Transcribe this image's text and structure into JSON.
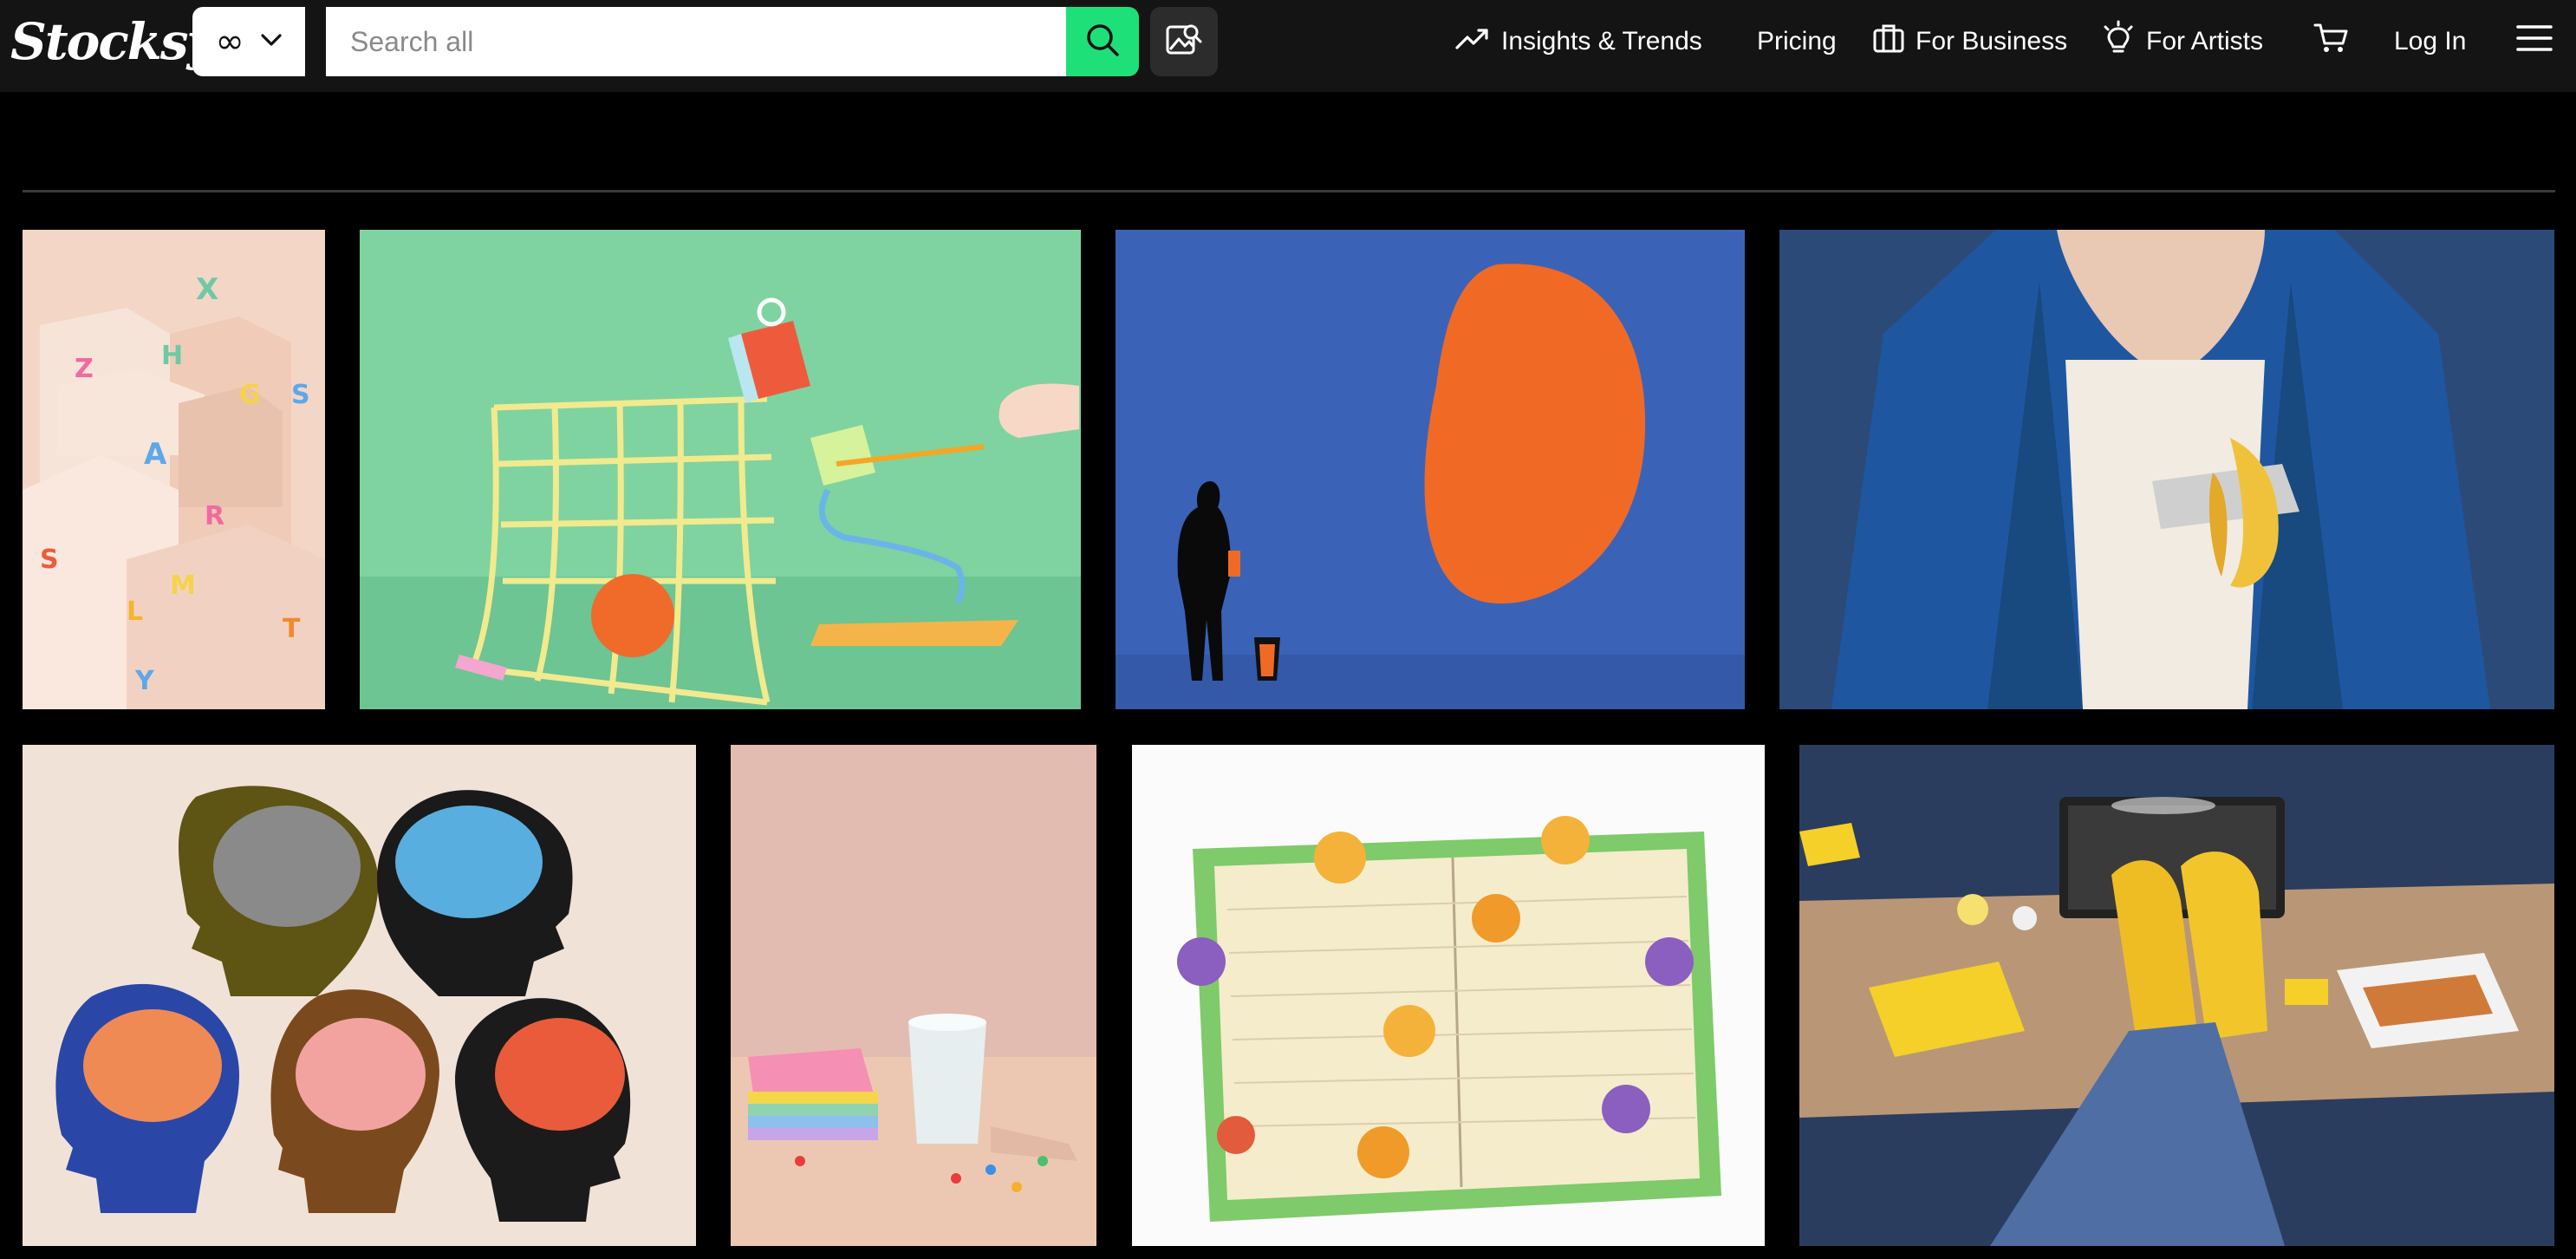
{
  "brand": {
    "logo_text": "Stocksy"
  },
  "search": {
    "scope": "∞",
    "placeholder": "Search all"
  },
  "nav": {
    "insights": "Insights & Trends",
    "pricing": "Pricing",
    "business": "For Business",
    "artists": "For Artists",
    "login": "Log In"
  },
  "colors": {
    "accent": "#1ee079",
    "header_bg": "#141414",
    "page_bg": "#000000"
  },
  "gallery": [
    {
      "name": "photo-alphabet-blocks"
    },
    {
      "name": "photo-grid-sculpture"
    },
    {
      "name": "photo-orange-paint-figure"
    },
    {
      "name": "photo-banana-blazer"
    },
    {
      "name": "photo-brain-heads"
    },
    {
      "name": "photo-sticky-notes-cup"
    },
    {
      "name": "photo-notebook-people"
    },
    {
      "name": "photo-yellow-shoes-desk"
    }
  ]
}
